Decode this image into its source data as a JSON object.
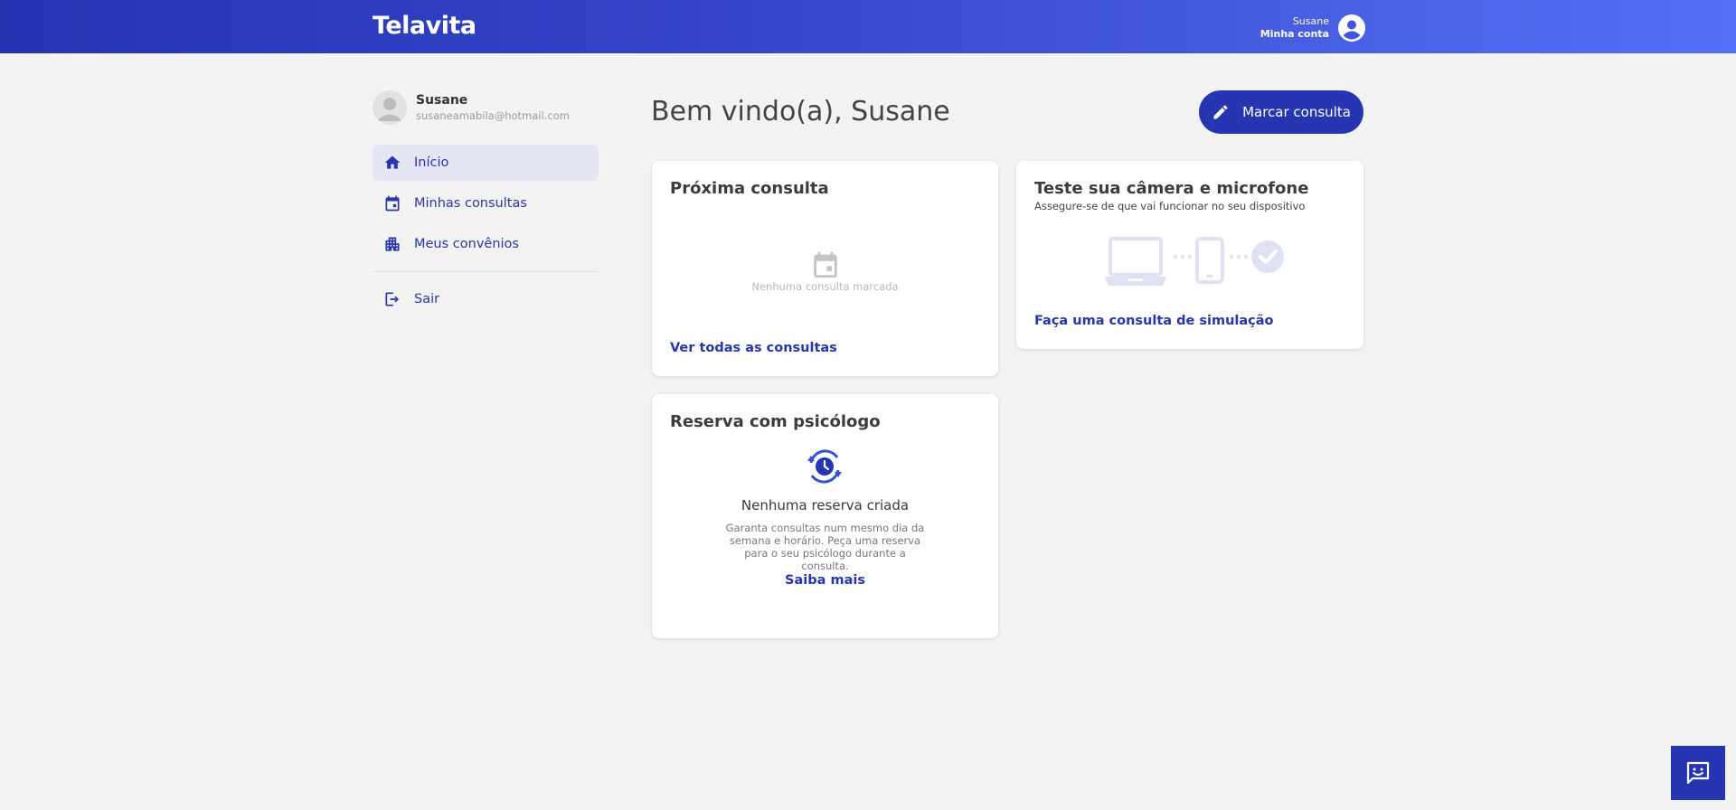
{
  "header": {
    "logo": "Telavita",
    "account_name": "Susane",
    "account_link": "Minha conta"
  },
  "sidebar": {
    "user_name": "Susane",
    "user_email": "susaneamabila@hotmail.com",
    "items": [
      {
        "label": "Início",
        "icon": "home-icon",
        "active": true
      },
      {
        "label": "Minhas consultas",
        "icon": "calendar-icon",
        "active": false
      },
      {
        "label": "Meus convênios",
        "icon": "building-icon",
        "active": false
      }
    ],
    "logout_label": "Sair"
  },
  "main": {
    "welcome": "Bem vindo(a), Susane",
    "cta_label": "Marcar consulta",
    "next_appointment": {
      "title": "Próxima consulta",
      "empty_text": "Nenhuma consulta marcada",
      "link": "Ver todas as consultas"
    },
    "device_test": {
      "title": "Teste sua câmera e microfone",
      "subtitle": "Assegure-se de que vai funcionar no seu dispositivo",
      "link": "Faça uma consulta de simulação"
    },
    "reservation": {
      "title": "Reserva com psicólogo",
      "heading": "Nenhuma reserva criada",
      "description": "Garanta consultas num mesmo dia da semana e horário. Peça uma reserva para o seu psicólogo durante a consulta.",
      "link": "Saiba mais"
    }
  },
  "colors": {
    "brand": "#2636b3",
    "header_gradient_start": "#2634b4",
    "header_gradient_end": "#5470f6",
    "background": "#f3f3f3"
  }
}
